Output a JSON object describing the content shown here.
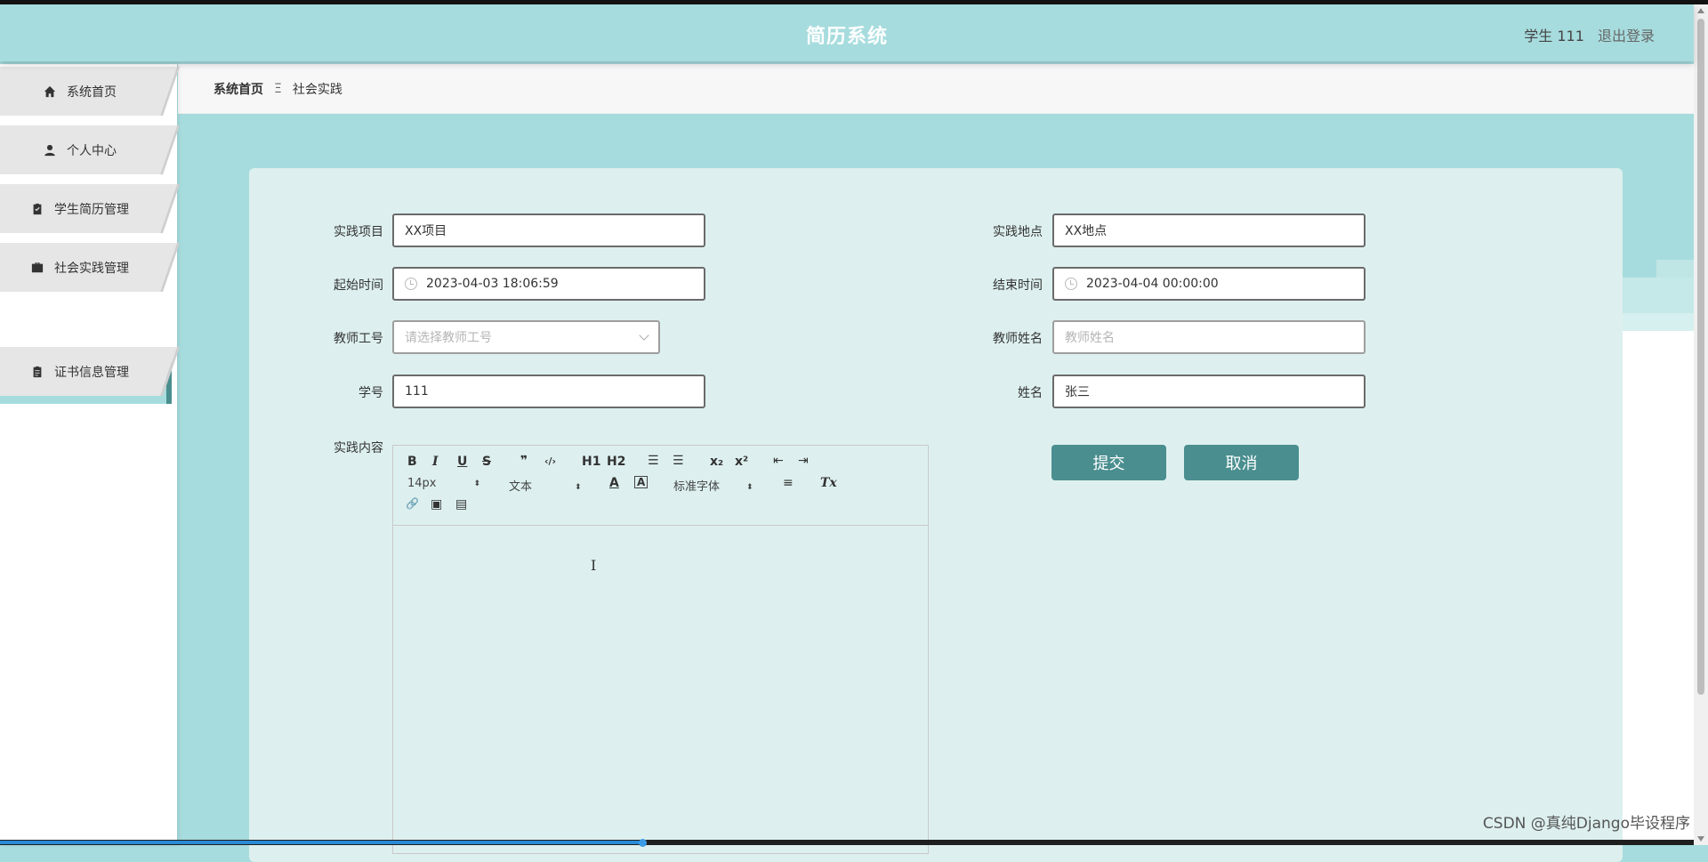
{
  "header": {
    "title": "简历系统",
    "user_label": "学生 111",
    "logout_label": "退出登录"
  },
  "sidebar": {
    "items": [
      {
        "label": "系统首页",
        "icon": "home-icon"
      },
      {
        "label": "个人中心",
        "icon": "user-icon"
      },
      {
        "label": "学生简历管理",
        "icon": "clipboard-check-icon"
      },
      {
        "label": "社会实践管理",
        "icon": "briefcase-icon"
      },
      {
        "label": "证书信息管理",
        "icon": "clipboard-icon"
      }
    ],
    "active_sub": "社会实践"
  },
  "breadcrumb": {
    "home": "系统首页",
    "separator": "Ξ",
    "current": "社会实践"
  },
  "form": {
    "project": {
      "label": "实践项目",
      "value": "XX项目"
    },
    "location": {
      "label": "实践地点",
      "value": "XX地点"
    },
    "start_time": {
      "label": "起始时间",
      "value": "2023-04-03 18:06:59"
    },
    "end_time": {
      "label": "结束时间",
      "value": "2023-04-04 00:00:00"
    },
    "teacher_id": {
      "label": "教师工号",
      "placeholder": "请选择教师工号"
    },
    "teacher_name": {
      "label": "教师姓名",
      "placeholder": "教师姓名"
    },
    "student_id": {
      "label": "学号",
      "value": "111"
    },
    "name": {
      "label": "姓名",
      "value": "张三"
    },
    "content": {
      "label": "实践内容"
    },
    "submit_label": "提交",
    "cancel_label": "取消"
  },
  "editor": {
    "bold": "B",
    "italic": "I",
    "underline": "U",
    "strike": "S",
    "quote": "❞",
    "code": "‹/›",
    "h1": "H1",
    "h2": "H2",
    "ol": "☰",
    "ul": "☰",
    "sub": "x₂",
    "sup": "x²",
    "indent_out": "⇤",
    "indent_in": "⇥",
    "size": "14px",
    "header": "文本",
    "color": "A",
    "bg": "A",
    "font": "标准字体",
    "align": "≡",
    "clear": "Tx",
    "link": "🔗",
    "image": "▣",
    "video": "▤"
  },
  "watermark": "CSDN @真纯Django毕设程序",
  "colors": {
    "teal": "#a7dcde",
    "button": "#4a8e8f",
    "card": "#ddf0ef"
  }
}
